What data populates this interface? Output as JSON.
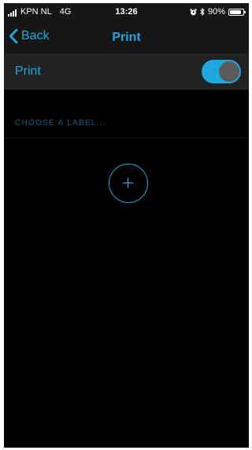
{
  "status_bar": {
    "carrier": "KPN NL",
    "network": "4G",
    "time": "13:26",
    "battery_percent": "90%",
    "battery_level": 0.9,
    "icons": [
      "signal-icon",
      "alarm-icon",
      "bluetooth-icon",
      "battery-icon"
    ]
  },
  "nav": {
    "back_label": "Back",
    "title": "Print"
  },
  "print_setting": {
    "label": "Print",
    "enabled": true
  },
  "labels_section": {
    "header": "CHOOSE A LABEL..."
  },
  "colors": {
    "accent": "#1fa8de",
    "background": "#000000",
    "bar_background": "#161616",
    "row_background": "#222222",
    "section_header": "#0d5f7f"
  }
}
